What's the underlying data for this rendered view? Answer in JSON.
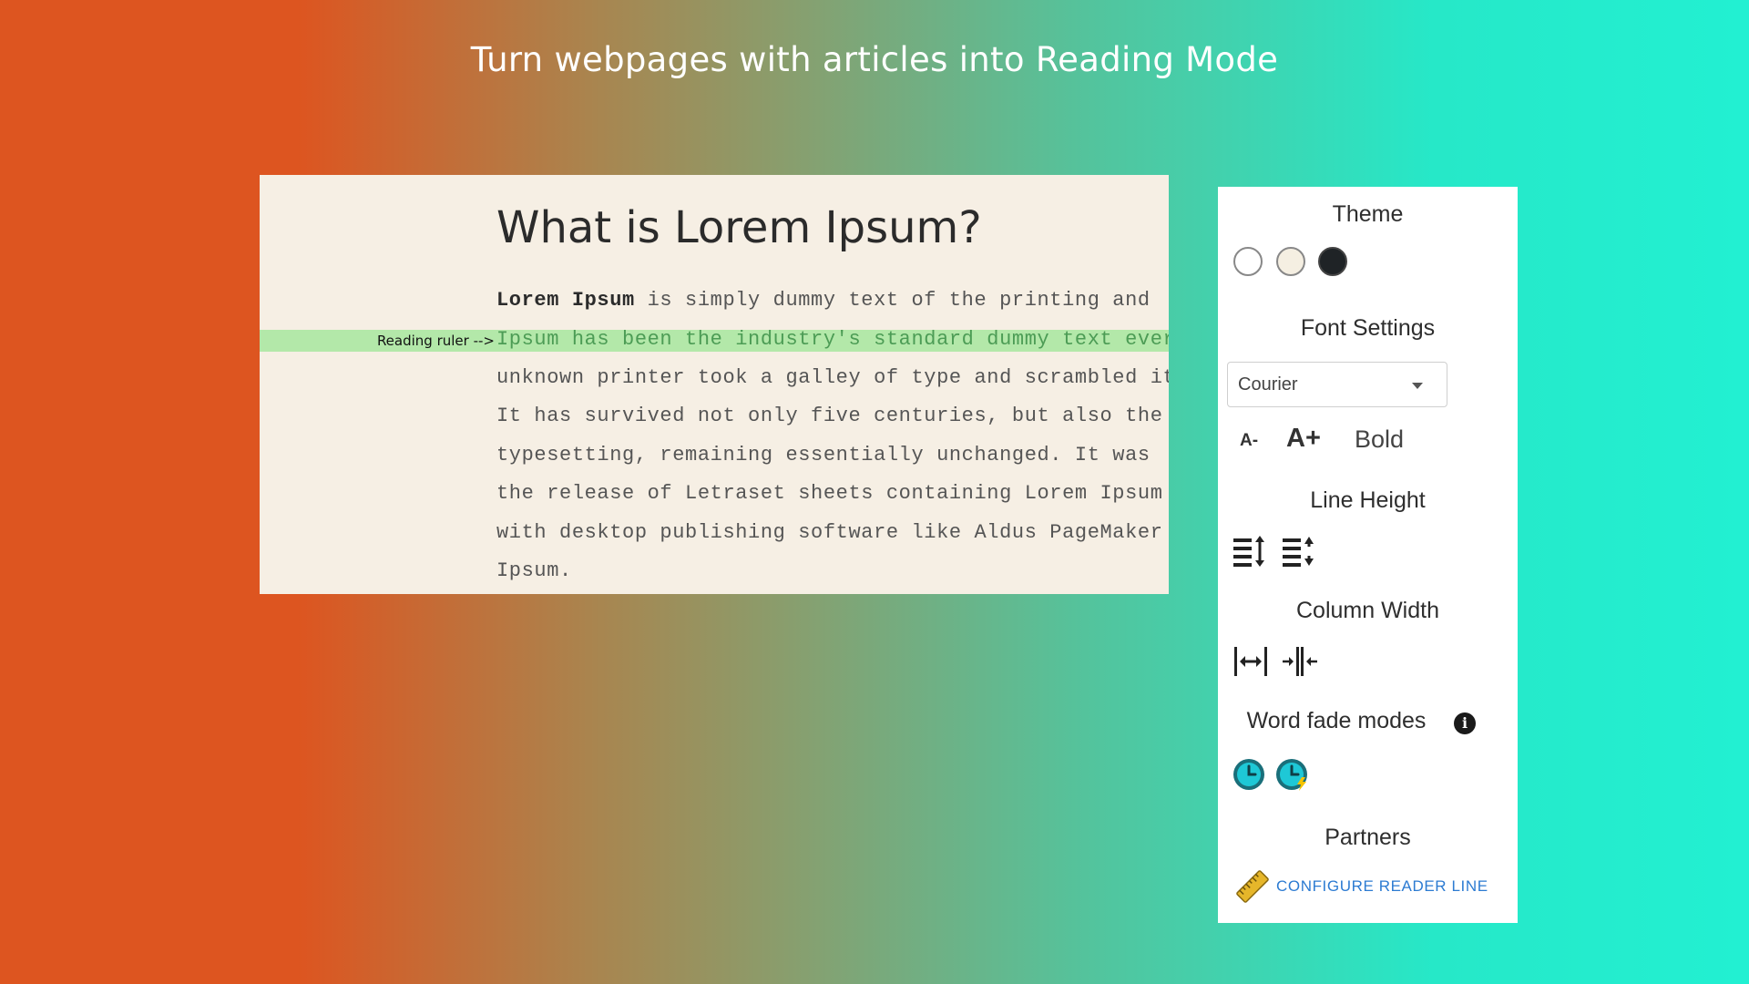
{
  "headline": "Turn webpages with articles into Reading Mode",
  "article": {
    "title": "What is Lorem Ipsum?",
    "lead_bold": "Lorem Ipsum",
    "line1_rest": " is simply dummy text of the printing and",
    "ruler_label": "Reading ruler -->",
    "lines": [
      "Ipsum has been the industry's standard dummy text ever",
      "unknown printer took a galley of type and scrambled it",
      "It has survived not only five centuries, but also the",
      "typesetting, remaining essentially unchanged. It was",
      "the release of Letraset sheets containing Lorem Ipsum",
      "with desktop publishing software like Aldus PageMaker",
      "Ipsum."
    ]
  },
  "panel": {
    "theme_title": "Theme",
    "themes": [
      {
        "name": "white",
        "color": "#ffffff"
      },
      {
        "name": "sepia",
        "color": "#f5efe2"
      },
      {
        "name": "dark",
        "color": "#1f2326"
      }
    ],
    "font_settings_title": "Font Settings",
    "font_select_value": "Courier",
    "font_decrease": "A-",
    "font_increase": "A+",
    "bold_label": "Bold",
    "line_height_title": "Line Height",
    "column_width_title": "Column Width",
    "word_fade_title": "Word fade modes",
    "info_glyph": "i",
    "partners_title": "Partners",
    "partner_link": "CONFIGURE READER LINE"
  },
  "colors": {
    "gradient_left": "#dd5520",
    "gradient_right": "#22f0d2",
    "ruler": "#b3e8a9",
    "article_bg": "#f6efe4",
    "link": "#2c7bd2",
    "fade_icon": "#1ec8d6"
  }
}
